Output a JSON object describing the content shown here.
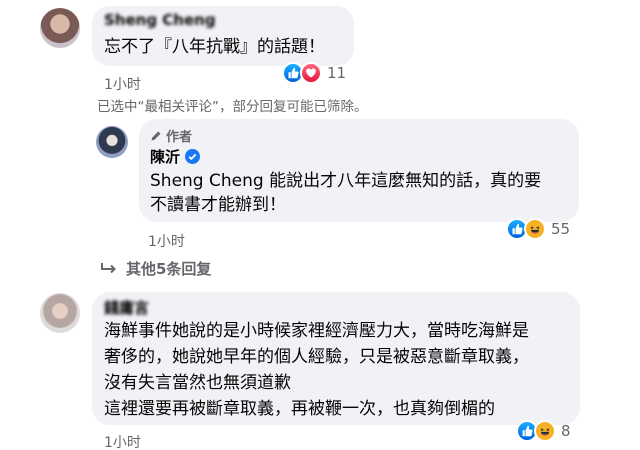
{
  "comments": [
    {
      "author": "Sheng Cheng",
      "text_lines": [
        "忘不了『八年抗戰』的話題！"
      ],
      "time": "1小时",
      "reaction_count": "11"
    },
    {
      "author_badge": "作者",
      "author": "陳沂",
      "text_lines": [
        "Sheng Cheng 能說出才八年這麼無知的話，真的要",
        "不讀書才能辦到！"
      ],
      "time": "1小时",
      "reaction_count": "55"
    },
    {
      "author": "錢庸言",
      "text_lines": [
        "海鮮事件她說的是小時候家裡經濟壓力大，當時吃海鮮是",
        "奢侈的，她說她早年的個人經驗，只是被惡意斷章取義，",
        "沒有失言當然也無須道歉",
        "這裡還要再被斷章取義，再被鞭一次，也真夠倒楣的"
      ],
      "time": "1小时",
      "reaction_count": "8"
    }
  ],
  "filter_notice": "已选中“最相关评论”，部分回复可能已筛除。",
  "more_replies": "其他5条回复",
  "colors": {
    "bubble": "#f0f2f5",
    "meta": "#65676b",
    "like": "#1877f2",
    "love": "#f33e58",
    "haha": "#f7b125"
  }
}
